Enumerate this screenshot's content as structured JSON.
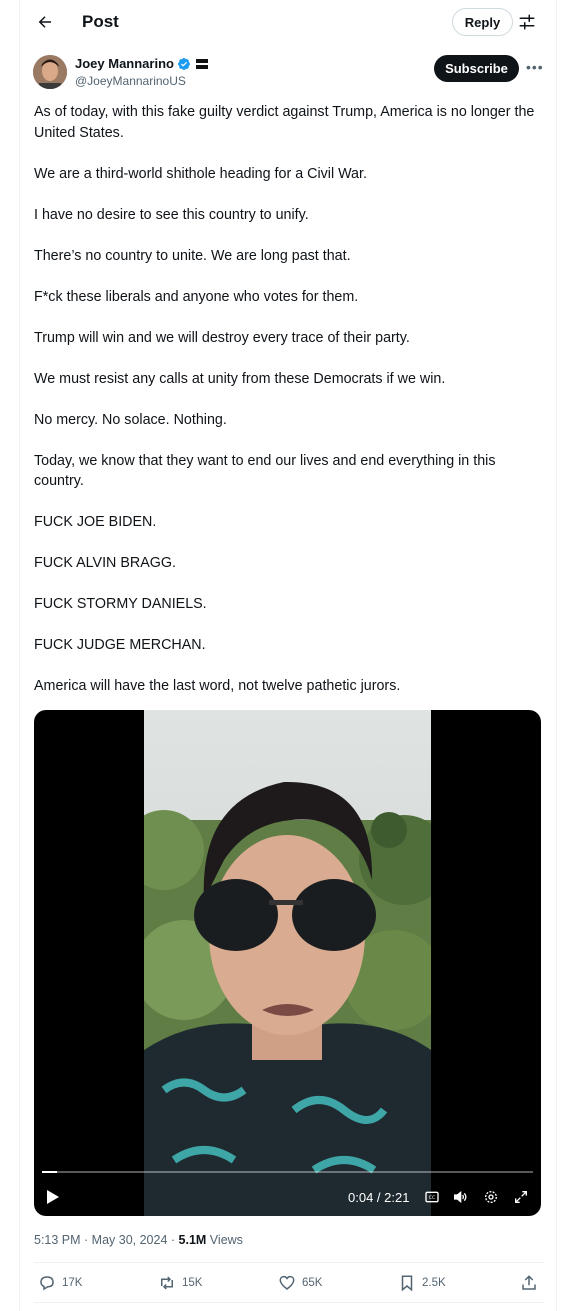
{
  "header": {
    "title": "Post",
    "reply_label": "Reply",
    "back_icon": "arrow-left-icon",
    "settings_icon": "tune-icon"
  },
  "author": {
    "name": "Joey Mannarino",
    "handle": "@JoeyMannarinoUS",
    "subscribe_label": "Subscribe",
    "verified_color": "#1d9bf0"
  },
  "post": {
    "paragraphs": [
      "As of today, with this fake guilty verdict against Trump, America is no longer the United States.",
      "We are a third-world shithole heading for a Civil War.",
      "I have no desire to see this country to unify.",
      "There’s no country to unite. We are long past that.",
      "F*ck these liberals and anyone who votes for them.",
      "Trump will win and we will destroy every trace of their party.",
      "We must resist any calls at unity from these Democrats if we win.",
      "No mercy. No solace. Nothing.",
      "Today, we know that they want to end our lives and end everything in this country.",
      "FUCK JOE BIDEN.",
      "FUCK ALVIN BRAGG.",
      "FUCK STORMY DANIELS.",
      "FUCK JUDGE MERCHAN.",
      "America will have the last word, not twelve pathetic jurors."
    ]
  },
  "video": {
    "time": "0:04 / 2:21",
    "progress": 0.03
  },
  "meta": {
    "time": "5:13 PM",
    "sep1": " · ",
    "date": "May 30, 2024",
    "sep2": " · ",
    "views_count": "5.1M",
    "views_label": " Views"
  },
  "actions": {
    "replies": "17K",
    "reposts": "15K",
    "likes": "65K",
    "bookmarks": "2.5K"
  },
  "colors": {
    "text": "#0f1419",
    "muted": "#536471",
    "border": "#eff3f4",
    "accent": "#1d9bf0"
  }
}
